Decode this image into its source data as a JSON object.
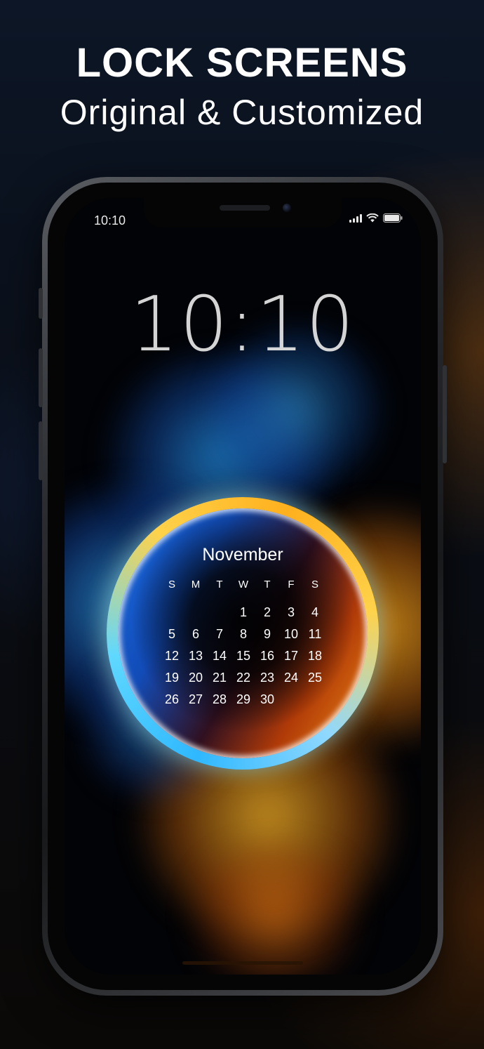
{
  "header": {
    "headline": "LOCK SCREENS",
    "subheadline": "Original & Customized"
  },
  "phone": {
    "status_bar": {
      "time": "10:10",
      "icons": [
        "signal-icon",
        "wifi-icon",
        "battery-icon"
      ]
    },
    "lock_clock": "10:10",
    "calendar": {
      "month": "November",
      "weekdays": [
        "S",
        "M",
        "T",
        "W",
        "T",
        "F",
        "S"
      ],
      "weeks": [
        [
          "",
          "",
          "",
          "1",
          "2",
          "3",
          "4"
        ],
        [
          "5",
          "6",
          "7",
          "8",
          "9",
          "10",
          "11"
        ],
        [
          "12",
          "13",
          "14",
          "15",
          "16",
          "17",
          "18"
        ],
        [
          "19",
          "20",
          "21",
          "22",
          "23",
          "24",
          "25"
        ],
        [
          "26",
          "27",
          "28",
          "29",
          "30",
          "",
          ""
        ]
      ]
    }
  },
  "colors": {
    "fire_blue": "#2fb8ff",
    "fire_orange": "#ffb01e",
    "text": "#ffffff"
  }
}
